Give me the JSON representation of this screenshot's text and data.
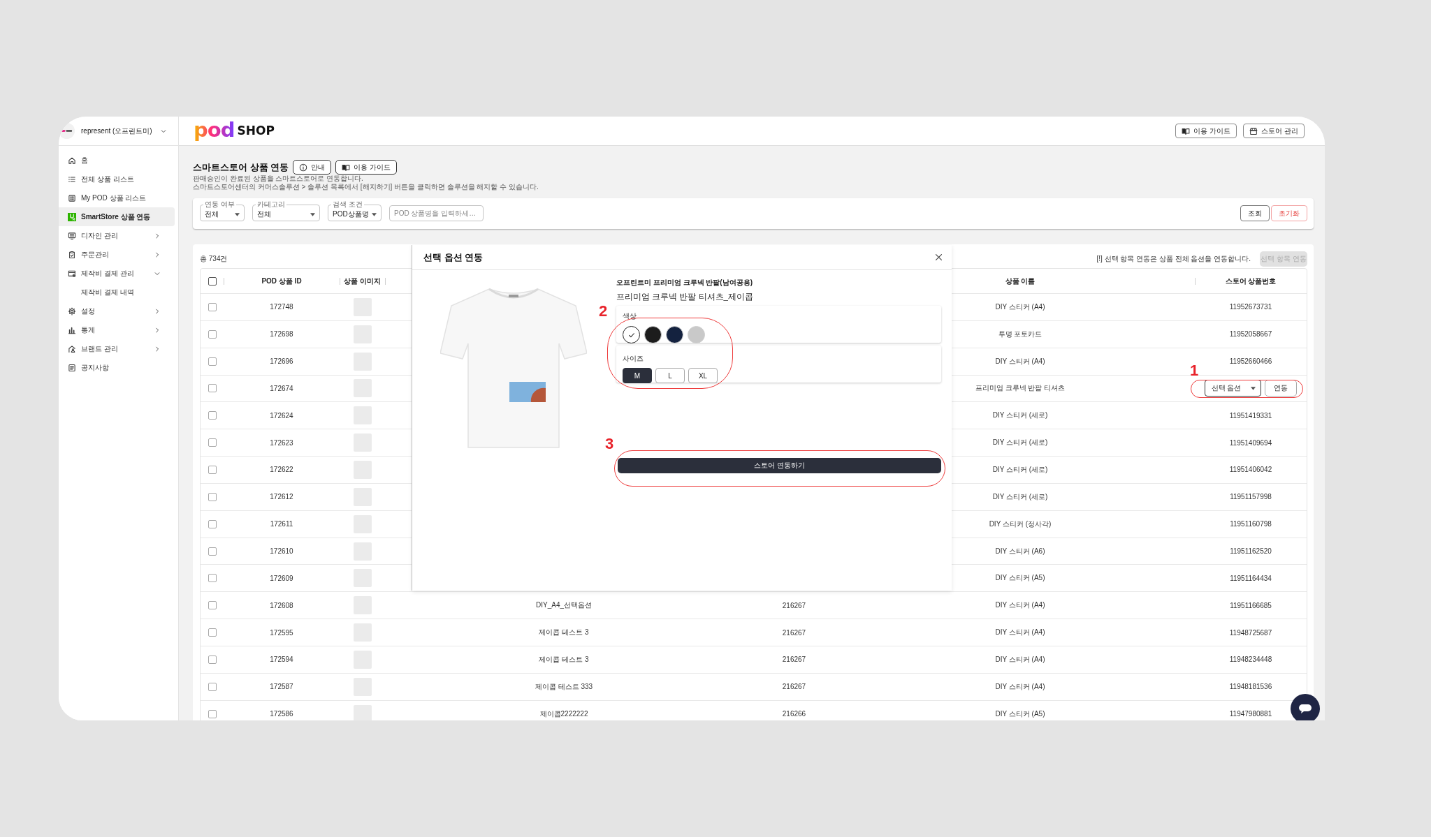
{
  "sidebar": {
    "account": {
      "name": "represent (오프린트미)"
    },
    "items": [
      {
        "kind": "link",
        "label": "홈",
        "selected": false
      },
      {
        "kind": "link",
        "label": "전체 상품 리스트",
        "selected": false
      },
      {
        "kind": "link",
        "label": "My POD 상품 리스트",
        "selected": false
      },
      {
        "kind": "link",
        "label": "SmartStore 상품 연동",
        "selected": true
      },
      {
        "kind": "group",
        "label": "디자인 관리",
        "selected": false,
        "expanded": false
      },
      {
        "kind": "group",
        "label": "주문관리",
        "selected": false,
        "expanded": false
      },
      {
        "kind": "group",
        "label": "제작비 결제 관리",
        "selected": false,
        "expanded": true,
        "children": [
          {
            "kind": "link",
            "label": "제작비 결제 내역",
            "selected": false
          }
        ]
      },
      {
        "kind": "group",
        "label": "설정",
        "selected": false,
        "expanded": false
      },
      {
        "kind": "group",
        "label": "통계",
        "selected": false,
        "expanded": false
      },
      {
        "kind": "group",
        "label": "브랜드 관리",
        "selected": false,
        "expanded": false
      },
      {
        "kind": "link",
        "label": "공지사항",
        "selected": false
      }
    ]
  },
  "header": {
    "logo_mark": "pod",
    "logo_text": "SHOP",
    "buttons": [
      {
        "label": "이용 가이드"
      },
      {
        "label": "스토어 관리"
      }
    ]
  },
  "page": {
    "title": "스마트스토어 상품 연동",
    "title_buttons": [
      {
        "label": "안내"
      },
      {
        "label": "이용 가이드"
      }
    ],
    "description": [
      "판매승인이 완료된 상품을 스마트스토어로 연동합니다.",
      "스마트스토어센터의 커머스솔루션 > 솔루션 목록에서 [해지하기] 버튼을 클릭하면 솔루션을 해지할 수 있습니다."
    ]
  },
  "filters": {
    "fields": [
      {
        "kind": "select",
        "label": "연동 여부",
        "value": "전체"
      },
      {
        "kind": "select",
        "label": "카테고리",
        "value": "전체"
      },
      {
        "kind": "select",
        "label": "검색 조건",
        "value": "POD상품명"
      },
      {
        "kind": "input",
        "placeholder": "POD 상품명을 입력하세…"
      }
    ],
    "actions": [
      {
        "kind": "primary",
        "label": "조회"
      },
      {
        "kind": "reset",
        "label": "초기화"
      }
    ]
  },
  "table": {
    "total": "총 734건",
    "notice": "[!] 선택 항목 연동은 상품 전체 옵션을 연동합니다.",
    "bulk_button": {
      "label": "선택 항목 연동",
      "disabled": true
    },
    "all_checked": false,
    "columns": {
      "id": "POD 상품 ID",
      "image": "상품 이미지",
      "name": "상품 이름",
      "store_no": "스토어 상품번호"
    },
    "rows": [
      {
        "checked": false,
        "id": "172748",
        "name": "DIY 스티커 (A4)",
        "store_no": "11952673731"
      },
      {
        "checked": false,
        "id": "172698",
        "name": "투명 포토카드",
        "store_no": "11952058667"
      },
      {
        "checked": false,
        "id": "172696",
        "name": "DIY 스티커 (A4)",
        "store_no": "11952660466"
      },
      {
        "checked": false,
        "id": "172674",
        "name": "프리미엄 크루넥 반팔 티셔츠",
        "store_action": {
          "select": "선택 옵션",
          "button": "연동"
        }
      },
      {
        "checked": false,
        "id": "172624",
        "name": "DIY 스티커 (세로)",
        "store_no": "11951419331"
      },
      {
        "checked": false,
        "id": "172623",
        "name": "DIY 스티커 (세로)",
        "store_no": "11951409694"
      },
      {
        "checked": false,
        "id": "172622",
        "name": "DIY 스티커 (세로)",
        "store_no": "11951406042"
      },
      {
        "checked": false,
        "id": "172612",
        "name": "DIY 스티커 (세로)",
        "store_no": "11951157998"
      },
      {
        "checked": false,
        "id": "172611",
        "name": "DIY 스티커 (정사각)",
        "store_no": "11951160798"
      },
      {
        "checked": false,
        "id": "172610",
        "name": "DIY 스티커 (A6)",
        "store_no": "11951162520"
      },
      {
        "checked": false,
        "id": "172609",
        "name": "DIY 스티커 (A5)",
        "store_no": "11951164434"
      },
      {
        "checked": false,
        "id": "172608",
        "column_3": "DIY_A4_선택옵션",
        "column_4": "216267",
        "name": "DIY 스티커 (A4)",
        "store_no": "11951166685"
      },
      {
        "checked": false,
        "id": "172595",
        "column_3": "제이콥 테스트 3",
        "column_4": "216267",
        "name": "DIY 스티커 (A4)",
        "store_no": "11948725687"
      },
      {
        "checked": false,
        "id": "172594",
        "column_3": "제이콥 테스트 3",
        "column_4": "216267",
        "name": "DIY 스티커 (A4)",
        "store_no": "11948234448"
      },
      {
        "checked": false,
        "id": "172587",
        "column_3": "제이콥 테스트 333",
        "column_4": "216267",
        "name": "DIY 스티커 (A4)",
        "store_no": "11948181536"
      },
      {
        "checked": false,
        "id": "172586",
        "column_3": "제이콥2222222",
        "column_4": "216266",
        "name": "DIY 스티커 (A5)",
        "store_no": "11947980881"
      }
    ]
  },
  "modal": {
    "title": "선택 옵션 연동",
    "brand": "오프린트미 프리미엄 크루넥 반팔(남여공용)",
    "product": "프리미엄 크루넥 반팔 티셔츠_제이콥",
    "options": [
      {
        "kind": "color",
        "label": "색상",
        "choices": [
          {
            "color": "#ffffff",
            "selected": true
          },
          {
            "color": "#1c1c1c",
            "selected": false
          },
          {
            "color": "#14223f",
            "selected": false
          },
          {
            "color": "#c9c9c9",
            "selected": false
          }
        ]
      },
      {
        "kind": "size",
        "label": "사이즈",
        "choices": [
          {
            "label": "M",
            "selected": true
          },
          {
            "label": "L",
            "selected": false
          },
          {
            "label": "XL",
            "selected": false
          }
        ]
      }
    ],
    "submit": "스토어 연동하기"
  },
  "annotations": [
    {
      "label": "1"
    },
    {
      "label": "2"
    },
    {
      "label": "3"
    }
  ]
}
